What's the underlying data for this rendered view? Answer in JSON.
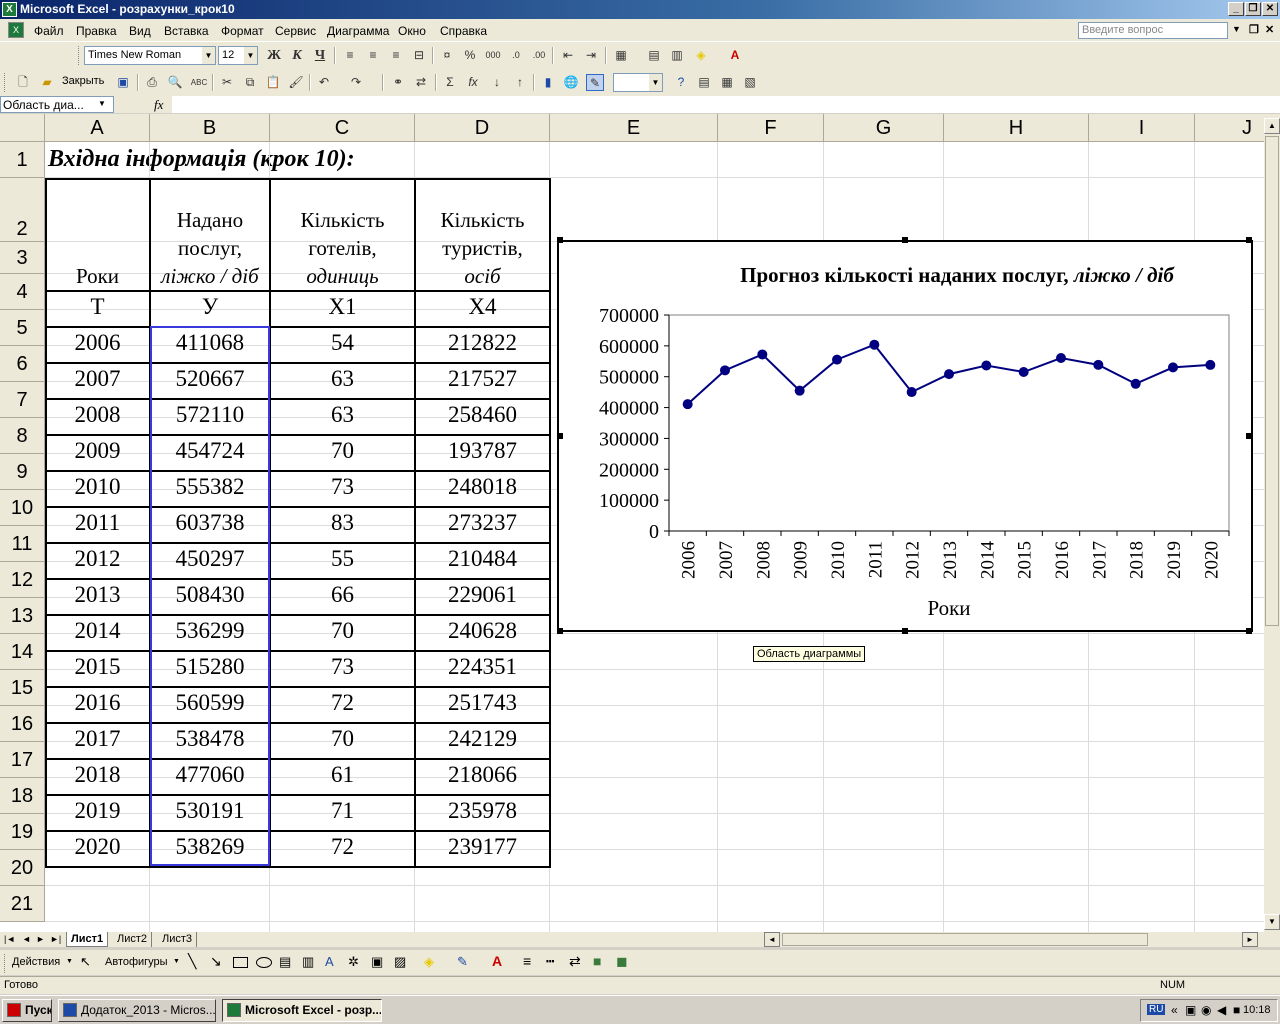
{
  "window": {
    "title": "Microsoft Excel - розрахунки_крок10",
    "controls": [
      "_",
      "❐",
      "✕"
    ]
  },
  "menu": {
    "items": [
      "Файл",
      "Правка",
      "Вид",
      "Вставка",
      "Формат",
      "Сервис",
      "Диаграмма",
      "Окно",
      "Справка"
    ],
    "ask_placeholder": "Введите вопрос"
  },
  "toolbar": {
    "font_name": "Times New Roman",
    "font_size": "12",
    "bold": "Ж",
    "italic": "К",
    "underline": "Ч",
    "close_label": "Закрыть"
  },
  "formula_bar": {
    "name_box": "Область диа...",
    "fx": "fx",
    "value": ""
  },
  "columns": [
    "A",
    "B",
    "C",
    "D",
    "E",
    "F",
    "G",
    "H",
    "I",
    "J"
  ],
  "rows": [
    "1",
    "2",
    "3",
    "4",
    "5",
    "6",
    "7",
    "8",
    "9",
    "10",
    "11",
    "12",
    "13",
    "14",
    "15",
    "16",
    "17",
    "18",
    "19",
    "20",
    "21"
  ],
  "sheet": {
    "a1_title": "Вхідна інформація (крок 10):",
    "headers": {
      "years": "Роки",
      "services_1": "Надано",
      "services_2": "послуг,",
      "services_3": "ліжко / діб",
      "hotels_1": "Кількість",
      "hotels_2": "готелів,",
      "hotels_3": "одиниць",
      "tourists_1": "Кількість",
      "tourists_2": "туристів,",
      "tourists_3": "осіб"
    },
    "symbols": [
      "T",
      "У",
      "X1",
      "X4"
    ],
    "data": [
      [
        "2006",
        "411068",
        "54",
        "212822"
      ],
      [
        "2007",
        "520667",
        "63",
        "217527"
      ],
      [
        "2008",
        "572110",
        "63",
        "258460"
      ],
      [
        "2009",
        "454724",
        "70",
        "193787"
      ],
      [
        "2010",
        "555382",
        "73",
        "248018"
      ],
      [
        "2011",
        "603738",
        "83",
        "273237"
      ],
      [
        "2012",
        "450297",
        "55",
        "210484"
      ],
      [
        "2013",
        "508430",
        "66",
        "229061"
      ],
      [
        "2014",
        "536299",
        "70",
        "240628"
      ],
      [
        "2015",
        "515280",
        "73",
        "224351"
      ],
      [
        "2016",
        "560599",
        "72",
        "251743"
      ],
      [
        "2017",
        "538478",
        "70",
        "242129"
      ],
      [
        "2018",
        "477060",
        "61",
        "218066"
      ],
      [
        "2019",
        "530191",
        "71",
        "235978"
      ],
      [
        "2020",
        "538269",
        "72",
        "239177"
      ]
    ]
  },
  "chart_data": {
    "type": "line",
    "title": "Прогноз кількості наданих послуг,",
    "title_italic": "ліжко / діб",
    "xlabel": "Роки",
    "ylabel": "",
    "categories": [
      "2006",
      "2007",
      "2008",
      "2009",
      "2010",
      "2011",
      "2012",
      "2013",
      "2014",
      "2015",
      "2016",
      "2017",
      "2018",
      "2019",
      "2020"
    ],
    "series": [
      {
        "values": [
          411068,
          520667,
          572110,
          454724,
          555382,
          603738,
          450297,
          508430,
          536299,
          515280,
          560599,
          538478,
          477060,
          530191,
          538269
        ]
      }
    ],
    "ylim": [
      0,
      700000
    ],
    "yticks": [
      "0",
      "100000",
      "200000",
      "300000",
      "400000",
      "500000",
      "600000",
      "700000"
    ],
    "grid": false,
    "legend": "none",
    "color": "#000080"
  },
  "tooltip": "Область диаграммы",
  "sheet_tabs": [
    "Лист1",
    "Лист2",
    "Лист3"
  ],
  "drawing": {
    "actions": "Действия",
    "autoshapes": "Автофигуры"
  },
  "status": {
    "ready": "Готово",
    "num": "NUM"
  },
  "taskbar": {
    "start": "Пуск",
    "tasks": [
      "Додаток_2013 - Micros...",
      "Microsoft Excel - розр..."
    ],
    "lang": "RU",
    "clock": "10:18"
  }
}
